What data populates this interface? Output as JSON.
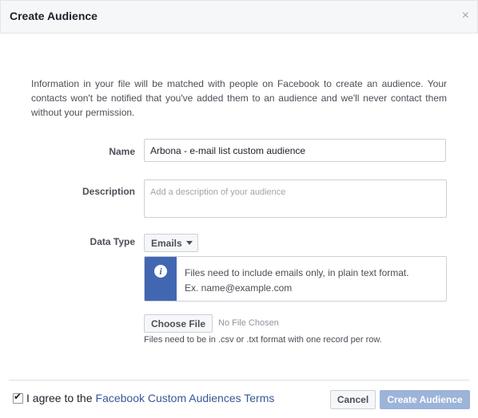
{
  "dialog": {
    "title": "Create Audience",
    "close_glyph": "×",
    "close_icon": "close-icon"
  },
  "intro": "Information in your file will be matched with people on Facebook to create an audience. Your contacts won't be notified that you've added them to an audience and we'll never contact them without your permission.",
  "form": {
    "name_label": "Name",
    "name_value": "Arbona - e-mail list custom audience",
    "description_label": "Description",
    "description_placeholder": "Add a description of your audience",
    "data_type_label": "Data Type",
    "data_type_selected": "Emails",
    "info_icon": "info-icon",
    "info_glyph": "i",
    "info_line_1": "Files need to include emails only, in plain text format.",
    "info_line_2": "Ex. name@example.com",
    "choose_file_label": "Choose File",
    "file_status": "No File Chosen",
    "file_hint": "Files need to be in .csv or .txt format with one record per row."
  },
  "footer": {
    "agree_checked": true,
    "check_glyph": "✔",
    "agree_text": "I agree to the",
    "terms_link": "Facebook Custom Audiences Terms",
    "cancel_label": "Cancel",
    "create_label": "Create Audience"
  },
  "colors": {
    "header_bg": "#f6f7f9",
    "accent": "#4267b2",
    "link": "#365899",
    "primary_disabled": "#9cb4d8"
  }
}
